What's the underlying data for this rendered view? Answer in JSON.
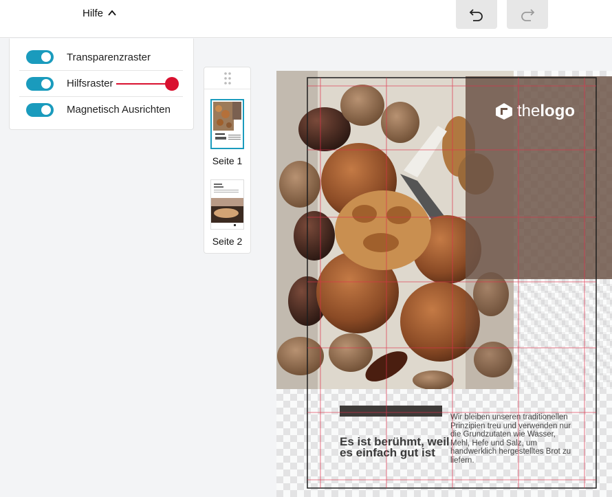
{
  "topbar": {
    "help_label": "Hilfe",
    "undo_icon": "undo-icon",
    "redo_icon": "redo-icon"
  },
  "settings": {
    "items": [
      {
        "label": "Transparenzraster",
        "on": true
      },
      {
        "label": "Hilfsraster",
        "on": true
      },
      {
        "label": "Magnetisch Ausrichten",
        "on": true
      }
    ]
  },
  "pages": {
    "items": [
      {
        "label": "Seite 1",
        "active": true
      },
      {
        "label": "Seite 2",
        "active": false
      }
    ]
  },
  "document": {
    "logo_prefix": "the",
    "logo_suffix": "logo",
    "headline": "Es ist berühmt, weil es einfach gut ist",
    "body": "Wir bleiben unseren traditionellen Prinzipien treu und verwenden nur die Grundzutaten wie Wasser, Mehl, Hefe und Salz, um handwerklich hergestelltes Brot zu liefern."
  },
  "colors": {
    "accent": "#1a9bbd",
    "guide_pointer": "#d9102f",
    "overlay_brown": "#6d5548",
    "dark_bar": "#3d3a38"
  }
}
